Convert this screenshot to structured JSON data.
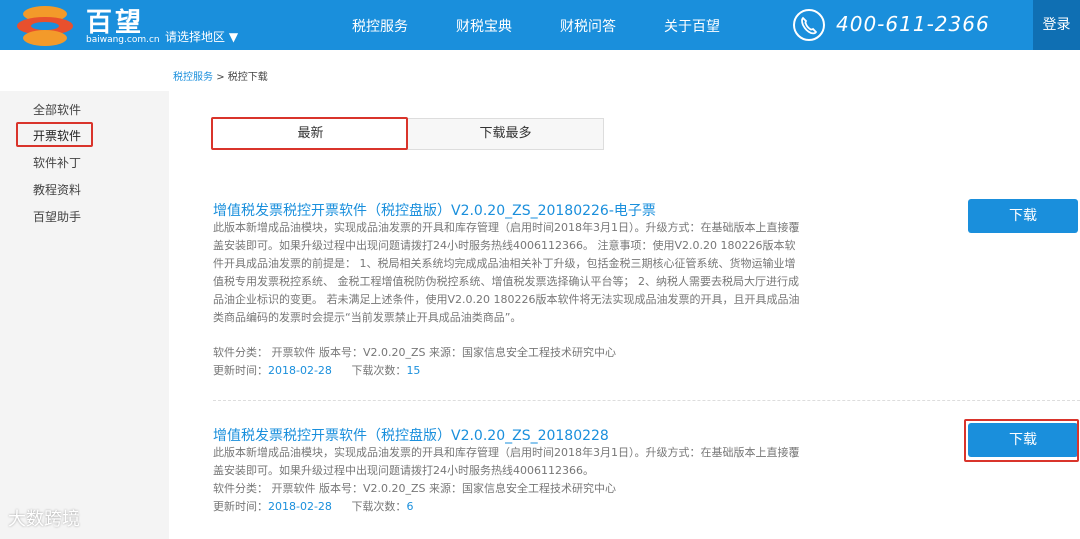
{
  "header": {
    "brand": "百望",
    "brand_sub": "baiwang.com.cn",
    "region": "请选择地区 ▼",
    "nav": [
      "税控服务",
      "财税宝典",
      "财税问答",
      "关于百望"
    ],
    "phone": "400-611-2366",
    "login": "登录",
    "color": "#1a8fdc"
  },
  "breadcrumb": {
    "link": "税控服务",
    "sep": ">",
    "current": "税控下载"
  },
  "sidebar": {
    "items": [
      "全部软件",
      "开票软件",
      "软件补丁",
      "教程资料",
      "百望助手"
    ]
  },
  "tabs": {
    "latest": "最新",
    "most": "下载最多"
  },
  "items": [
    {
      "title": "增值税发票税控开票软件（税控盘版）V2.0.20_ZS_20180226-电子票",
      "desc": "此版本新增成品油模块，实现成品油发票的开具和库存管理（启用时间2018年3月1日）。升级方式：在基础版本上直接覆盖安装即可。如果升级过程中出现问题请拨打24小时服务热线4006112366。 注意事项：使用V2.0.20 180226版本软件开具成品油发票的前提是： 1、税局相关系统均完成成品油相关补丁升级，包括金税三期核心征管系统、货物运输业增值税专用发票税控系统、 金税工程增值税防伪税控系统、增值税发票选择确认平台等； 2、纳税人需要去税局大厅进行成品油企业标识的变更。 若未满足上述条件，使用V2.0.20 180226版本软件将无法实现成品油发票的开具，且开具成品油类商品编码的发票时会提示“当前发票禁止开具成品油类商品”。",
      "meta1": "软件分类： 开票软件     版本号：V2.0.20_ZS     来源：国家信息安全工程技术研究中心",
      "date_label": "更新时间：",
      "date": "2018-02-28",
      "count_label": "下载次数：",
      "count": "15",
      "button": "下载"
    },
    {
      "title": "增值税发票税控开票软件（税控盘版）V2.0.20_ZS_20180228",
      "desc": "此版本新增成品油模块，实现成品油发票的开具和库存管理（启用时间2018年3月1日）。升级方式：在基础版本上直接覆盖安装即可。如果升级过程中出现问题请拨打24小时服务热线4006112366。",
      "meta1": "软件分类： 开票软件     版本号：V2.0.20_ZS     来源：国家信息安全工程技术研究中心",
      "date_label": "更新时间：",
      "date": "2018-02-28",
      "count_label": "下载次数：",
      "count": "6",
      "button": "下载"
    }
  ],
  "watermark": "大数跨境"
}
